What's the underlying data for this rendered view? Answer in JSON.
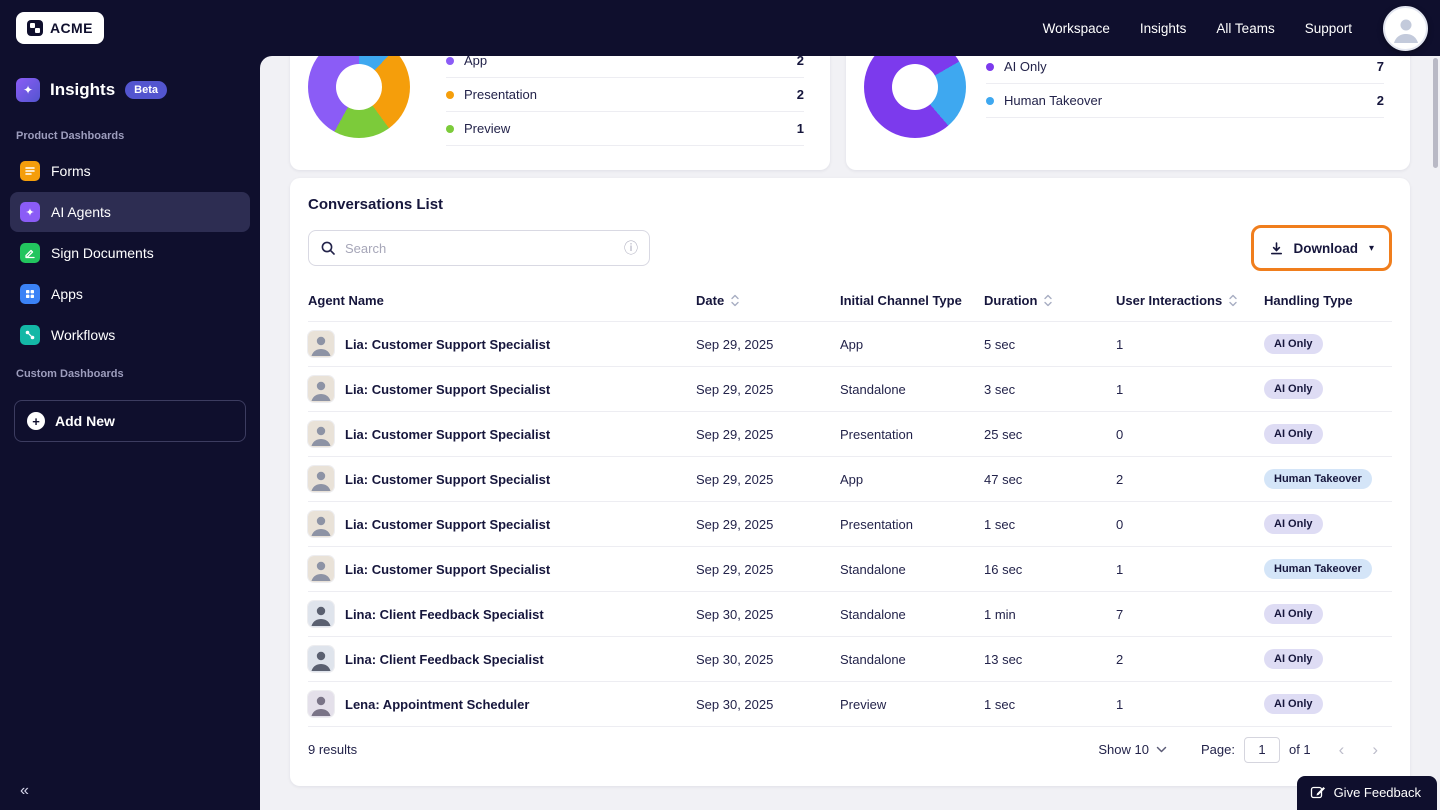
{
  "topbar": {
    "logo": "ACME",
    "nav": [
      "Workspace",
      "Insights",
      "All Teams",
      "Support"
    ]
  },
  "sidebar": {
    "title": "Insights",
    "beta": "Beta",
    "section1": "Product Dashboards",
    "items": [
      {
        "label": "Forms",
        "color": "#f59e0b"
      },
      {
        "label": "AI Agents",
        "color": "#8b5cf6"
      },
      {
        "label": "Sign Documents",
        "color": "#22c55e"
      },
      {
        "label": "Apps",
        "color": "#3b82f6"
      },
      {
        "label": "Workflows",
        "color": "#14b8a6"
      }
    ],
    "section2": "Custom Dashboards",
    "add_new": "Add New"
  },
  "icons": {
    "sparkle": "✦",
    "plus": "+",
    "collapse": "«",
    "info": "ⓘ",
    "caret_down": "▾",
    "chevron_down": "⌄",
    "prev": "‹",
    "next": "›"
  },
  "charts": {
    "channel": {
      "legend": [
        {
          "label": "App",
          "value": "2",
          "color": "#8b5cf6"
        },
        {
          "label": "Presentation",
          "value": "2",
          "color": "#f59e0b"
        },
        {
          "label": "Preview",
          "value": "1",
          "color": "#7ccb3a"
        }
      ],
      "donut": [
        {
          "color": "#3ea8f0",
          "pct": 12
        },
        {
          "color": "#f59e0b",
          "pct": 28
        },
        {
          "color": "#7ccb3a",
          "pct": 18
        },
        {
          "color": "#8b5cf6",
          "pct": 42
        }
      ]
    },
    "handling": {
      "legend": [
        {
          "label": "AI Only",
          "value": "7",
          "color": "#7c3aed"
        },
        {
          "label": "Human Takeover",
          "value": "2",
          "color": "#3ea8f0"
        }
      ],
      "donut": [
        {
          "color": "#3ea8f0",
          "pct": 22
        },
        {
          "color": "#7c3aed",
          "pct": 78
        }
      ]
    }
  },
  "conversations": {
    "title": "Conversations List",
    "search_placeholder": "Search",
    "download_label": "Download",
    "columns": [
      {
        "label": "Agent Name"
      },
      {
        "label": "Date"
      },
      {
        "label": "Initial Channel Type"
      },
      {
        "label": "Duration"
      },
      {
        "label": "User Interactions"
      },
      {
        "label": "Handling Type"
      }
    ],
    "rows": [
      {
        "agent": "Lia: Customer Support Specialist",
        "date": "Sep 29, 2025",
        "channel": "App",
        "duration": "5 sec",
        "interactions": "1",
        "handling": "AI Only"
      },
      {
        "agent": "Lia: Customer Support Specialist",
        "date": "Sep 29, 2025",
        "channel": "Standalone",
        "duration": "3 sec",
        "interactions": "1",
        "handling": "AI Only"
      },
      {
        "agent": "Lia: Customer Support Specialist",
        "date": "Sep 29, 2025",
        "channel": "Presentation",
        "duration": "25 sec",
        "interactions": "0",
        "handling": "AI Only"
      },
      {
        "agent": "Lia: Customer Support Specialist",
        "date": "Sep 29, 2025",
        "channel": "App",
        "duration": "47 sec",
        "interactions": "2",
        "handling": "Human Takeover"
      },
      {
        "agent": "Lia: Customer Support Specialist",
        "date": "Sep 29, 2025",
        "channel": "Presentation",
        "duration": "1 sec",
        "interactions": "0",
        "handling": "AI Only"
      },
      {
        "agent": "Lia: Customer Support Specialist",
        "date": "Sep 29, 2025",
        "channel": "Standalone",
        "duration": "16 sec",
        "interactions": "1",
        "handling": "Human Takeover"
      },
      {
        "agent": "Lina: Client Feedback Specialist",
        "date": "Sep 30, 2025",
        "channel": "Standalone",
        "duration": "1 min",
        "interactions": "7",
        "handling": "AI Only"
      },
      {
        "agent": "Lina: Client Feedback Specialist",
        "date": "Sep 30, 2025",
        "channel": "Standalone",
        "duration": "13 sec",
        "interactions": "2",
        "handling": "AI Only"
      },
      {
        "agent": "Lena: Appointment Scheduler",
        "date": "Sep 30, 2025",
        "channel": "Preview",
        "duration": "1 sec",
        "interactions": "1",
        "handling": "AI Only"
      }
    ],
    "footer": {
      "results": "9 results",
      "show_label": "Show 10",
      "page_label": "Page:",
      "page_value": "1",
      "of_label": "of 1"
    }
  },
  "feedback": {
    "label": "Give Feedback"
  }
}
